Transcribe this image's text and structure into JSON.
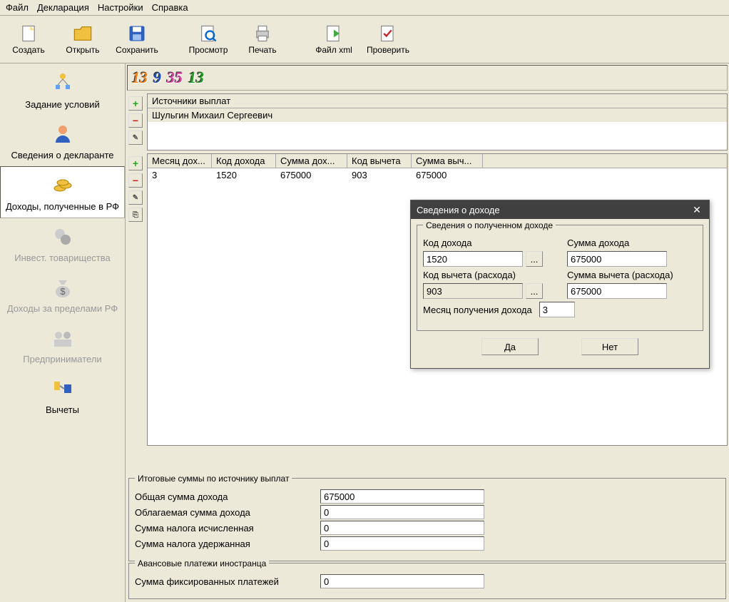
{
  "menu": {
    "file": "Файл",
    "decl": "Декларация",
    "settings": "Настройки",
    "help": "Справка"
  },
  "toolbar": {
    "create": "Создать",
    "open": "Открыть",
    "save": "Сохранить",
    "preview": "Просмотр",
    "print": "Печать",
    "xml": "Файл xml",
    "check": "Проверить"
  },
  "tabs": {
    "t1": "13",
    "t2": "9",
    "t3": "35",
    "t4": "13"
  },
  "sidebar": {
    "conditions": "Задание условий",
    "declarant": "Сведения о декларанте",
    "income_rf": "Доходы, полученные в РФ",
    "invest": "Инвест. товарищества",
    "income_abroad": "Доходы за пределами РФ",
    "entrepreneurs": "Предприниматели",
    "deductions": "Вычеты"
  },
  "sources": {
    "header": "Источники выплат",
    "row1": "Шульгин Михаил Сергеевич"
  },
  "income_table": {
    "h1": "Месяц дох...",
    "h2": "Код дохода",
    "h3": "Сумма дох...",
    "h4": "Код вычета",
    "h5": "Сумма выч...",
    "r1c1": "3",
    "r1c2": "1520",
    "r1c3": "675000",
    "r1c4": "903",
    "r1c5": "675000"
  },
  "totals": {
    "legend1": "Итоговые суммы по источнику выплат",
    "l1": "Общая сумма дохода",
    "v1": "675000",
    "l2": "Облагаемая сумма дохода",
    "v2": "0",
    "l3": "Сумма налога исчисленная",
    "v3": "0",
    "l4": "Сумма налога удержанная",
    "v4": "0",
    "legend2": "Авансовые платежи иностранца",
    "l5": "Сумма фиксированных платежей",
    "v5": "0"
  },
  "modal": {
    "title": "Сведения о доходе",
    "fs_legend": "Сведения о полученном доходе",
    "income_code_label": "Код дохода",
    "income_code": "1520",
    "income_sum_label": "Сумма дохода",
    "income_sum": "675000",
    "deduct_code_label": "Код вычета (расхода)",
    "deduct_code": "903",
    "deduct_sum_label": "Сумма вычета (расхода)",
    "deduct_sum": "675000",
    "month_label": "Месяц получения дохода",
    "month": "3",
    "yes": "Да",
    "no": "Нет"
  }
}
